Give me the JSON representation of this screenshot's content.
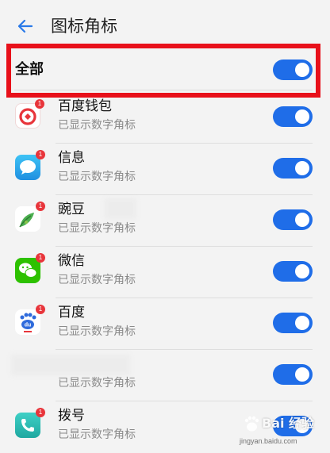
{
  "header": {
    "title": "图标角标"
  },
  "all_toggle": {
    "label": "全部",
    "on": true
  },
  "apps": [
    {
      "name": "百度钱包",
      "status": "已显示数字角标",
      "badge": "1",
      "icon": "baidu-wallet-icon",
      "on": true
    },
    {
      "name": "信息",
      "status": "已显示数字角标",
      "badge": "1",
      "icon": "messages-icon",
      "on": true
    },
    {
      "name": "豌豆",
      "status": "已显示数字角标",
      "badge": "1",
      "icon": "wandoujia-icon",
      "on": true
    },
    {
      "name": "微信",
      "status": "已显示数字角标",
      "badge": "1",
      "icon": "wechat-icon",
      "on": true
    },
    {
      "name": "百度",
      "status": "已显示数字角标",
      "badge": "1",
      "icon": "baidu-icon",
      "on": true
    },
    {
      "name": "",
      "status": "已显示数字角标",
      "badge": "",
      "icon": "",
      "on": true
    },
    {
      "name": "拨号",
      "status": "已显示数字角标",
      "badge": "1",
      "icon": "phone-dialer-icon",
      "on": true
    }
  ],
  "watermark": {
    "text": "Bai 经验",
    "url": "jingyan.baidu.com"
  },
  "colors": {
    "toggle_on": "#1f6de8",
    "highlight": "#e8101a",
    "badge": "#e8353b",
    "back_arrow": "#2979e8"
  }
}
